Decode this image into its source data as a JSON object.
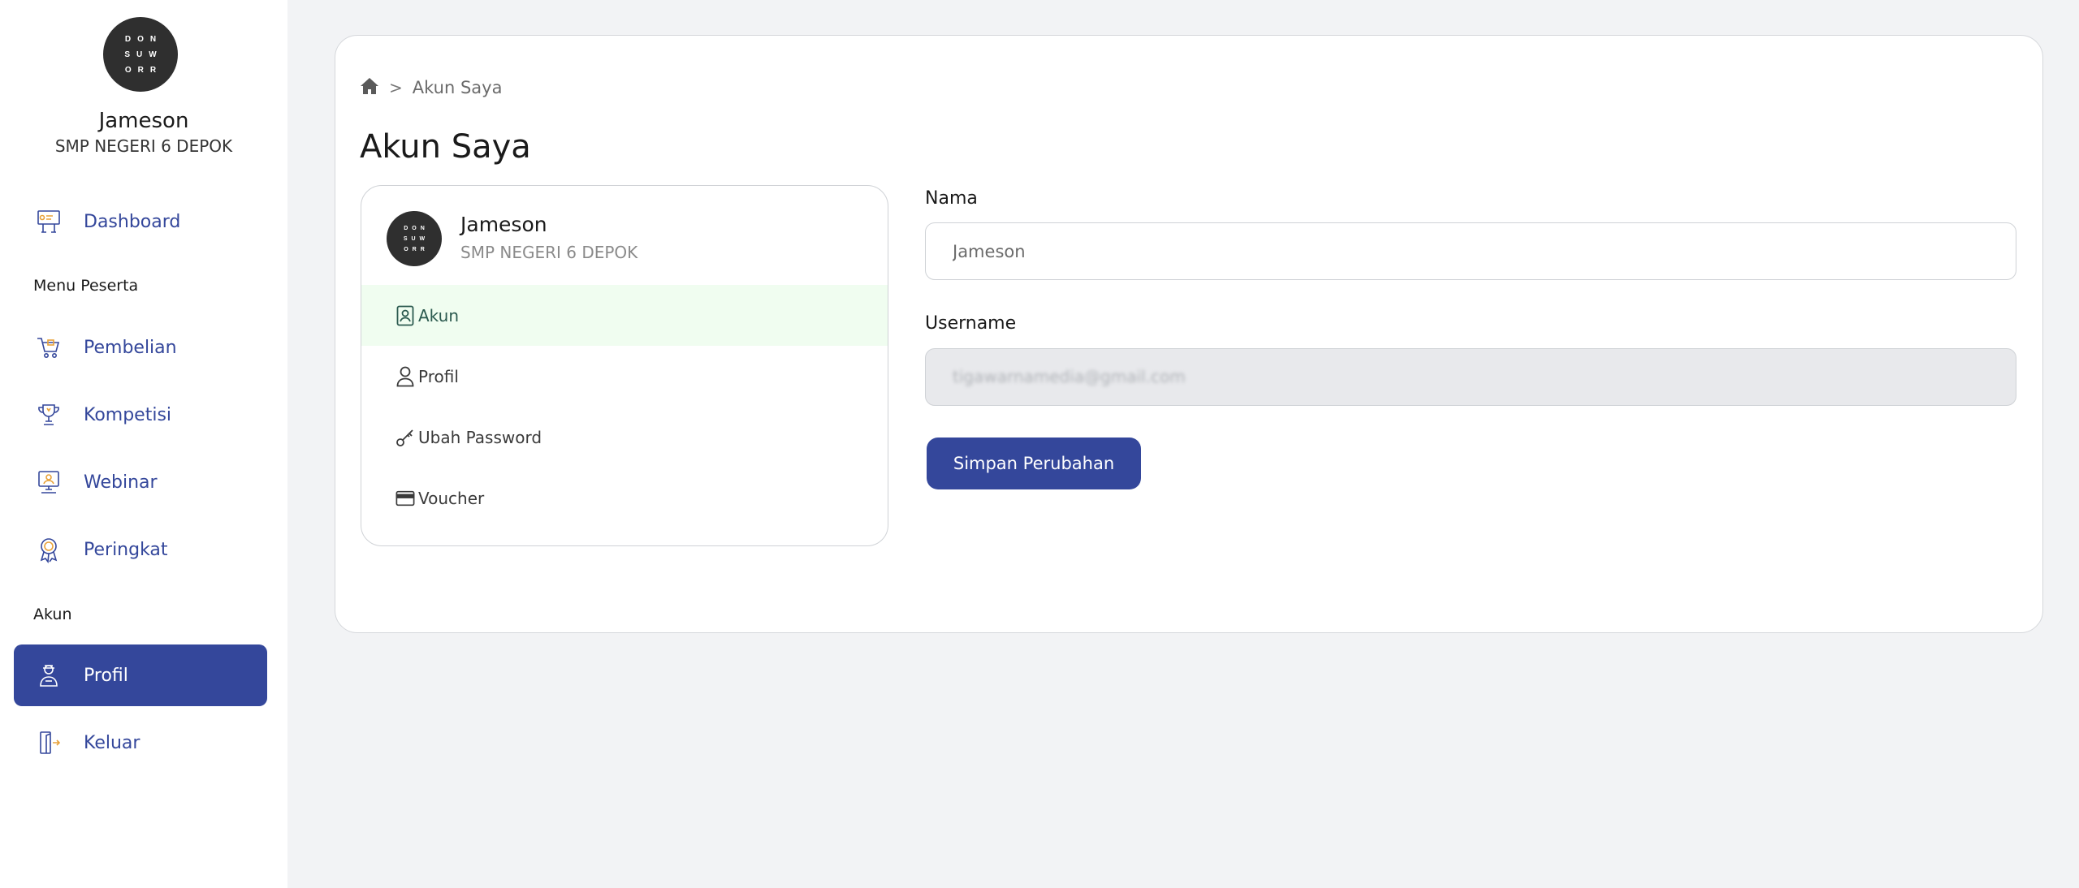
{
  "brand": {
    "logo_rows": [
      "DON",
      "SUW",
      "ORR"
    ]
  },
  "user": {
    "name": "Jameson",
    "school": "SMP NEGERI 6 DEPOK"
  },
  "sidebar": {
    "dashboard": {
      "label": "Dashboard",
      "icon": "presentation-board-icon"
    },
    "section_menu": "Menu Peserta",
    "items": [
      {
        "label": "Pembelian",
        "icon": "shopping-cart-icon"
      },
      {
        "label": "Kompetisi",
        "icon": "trophy-icon"
      },
      {
        "label": "Webinar",
        "icon": "monitor-icon"
      },
      {
        "label": "Peringkat",
        "icon": "medal-icon"
      }
    ],
    "section_account": "Akun",
    "profile": {
      "label": "Profil",
      "icon": "user-icon"
    },
    "logout": {
      "label": "Keluar",
      "icon": "door-exit-icon"
    }
  },
  "breadcrumb": {
    "current": "Akun Saya",
    "separator": ">"
  },
  "page": {
    "title": "Akun Saya"
  },
  "account_menu": {
    "items": [
      {
        "label": "Akun",
        "icon": "id-card-icon"
      },
      {
        "label": "Profil",
        "icon": "person-icon"
      },
      {
        "label": "Ubah Password",
        "icon": "key-icon"
      },
      {
        "label": "Voucher",
        "icon": "card-icon"
      }
    ]
  },
  "form": {
    "name_label": "Nama",
    "name_value": "Jameson",
    "username_label": "Username",
    "username_value": "tigawarnamedia@gmail.com",
    "save_label": "Simpan Perubahan"
  },
  "colors": {
    "accent": "#34479b",
    "active_menu_bg": "#f0fdf0",
    "page_bg": "#f2f3f5"
  }
}
